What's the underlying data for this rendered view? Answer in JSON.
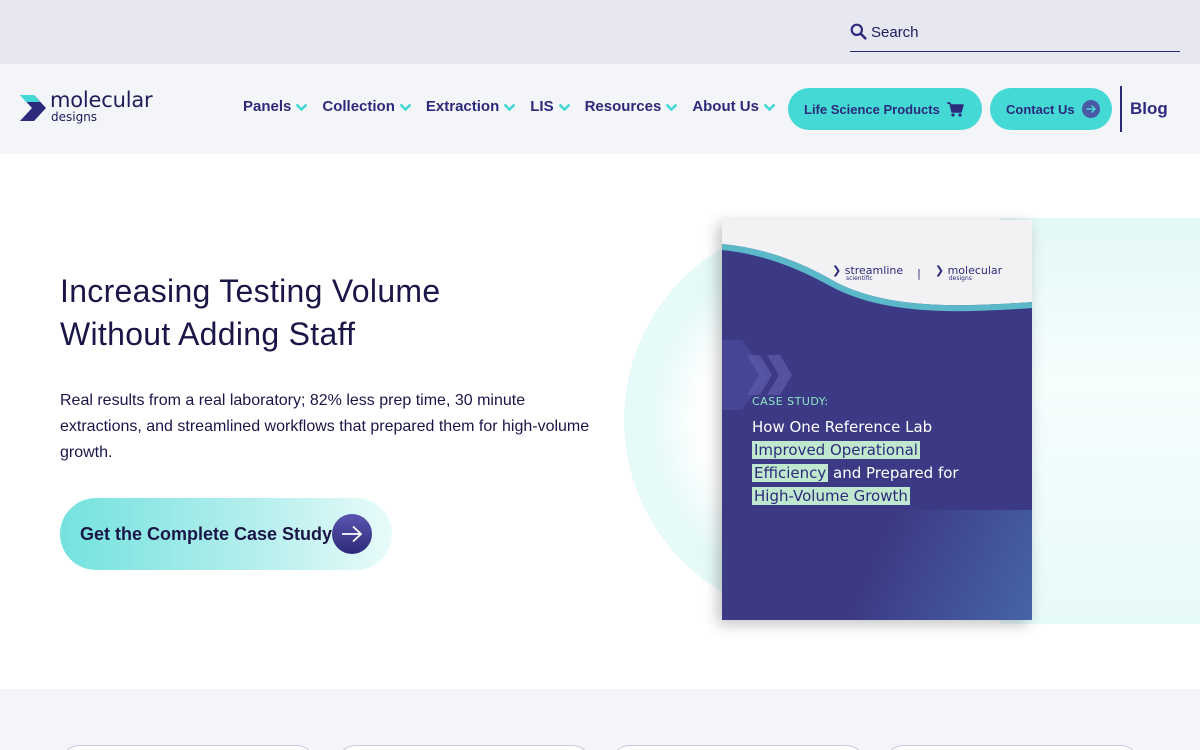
{
  "search": {
    "placeholder": "Search"
  },
  "brand": {
    "name": "molecular",
    "sub": "designs"
  },
  "nav": {
    "items": [
      {
        "label": "Panels"
      },
      {
        "label": "Collection"
      },
      {
        "label": "Extraction"
      },
      {
        "label": "LIS"
      },
      {
        "label": "Resources"
      },
      {
        "label": "About Us"
      }
    ],
    "life_science_label": "Life Science Products",
    "contact_label": "Contact Us",
    "blog_label": "Blog"
  },
  "hero": {
    "title_line1": "Increasing Testing Volume",
    "title_line2": "Without Adding Staff",
    "description": "Real results from a real laboratory; 82% less prep time, 30 minute extractions, and streamlined workflows that prepared them for high-volume growth.",
    "cta_label": "Get the Complete Case Study"
  },
  "book": {
    "partner_name": "streamline",
    "partner_sub": "scientific",
    "separator": "|",
    "brand_name": "molecular",
    "brand_sub": "designs",
    "kicker": "CASE STUDY:",
    "line1": "How One Reference Lab",
    "highlight1": "Improved Operational",
    "highlight2": "Efficiency",
    "line3_rest": " and Prepared for",
    "highlight3": "High-Volume Growth"
  },
  "colors": {
    "navy": "#2c2a7a",
    "teal": "#45d9d6",
    "topbar": "#e6e7f1",
    "navbar": "#f4f5f8"
  }
}
